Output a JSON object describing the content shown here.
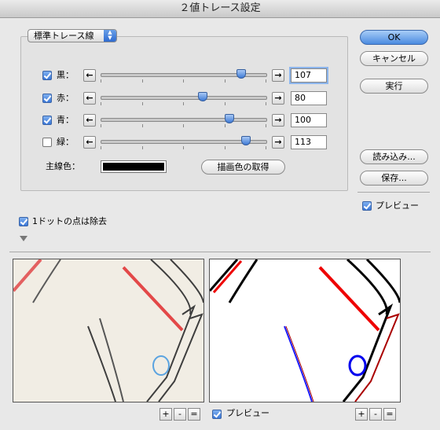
{
  "window": {
    "title": "２値トレース設定"
  },
  "preset": {
    "value": "標準トレース線"
  },
  "colors": [
    {
      "label": "黒：",
      "checked": true,
      "value": "107",
      "level": 0.85,
      "focused": true
    },
    {
      "label": "赤：",
      "checked": true,
      "value": "80",
      "level": 0.62,
      "focused": false
    },
    {
      "label": "青：",
      "checked": true,
      "value": "100",
      "level": 0.78,
      "focused": false
    },
    {
      "label": "緑：",
      "checked": false,
      "value": "113",
      "level": 0.88,
      "focused": false
    }
  ],
  "arrows": {
    "left": "←",
    "right": "→"
  },
  "main_line": {
    "label": "主線色：",
    "color": "#000000",
    "get_button": "描画色の取得"
  },
  "buttons": {
    "ok": "OK",
    "cancel": "キャンセル",
    "run": "実行",
    "load": "読み込み...",
    "save": "保存..."
  },
  "preview": {
    "label": "プレビュー",
    "checked": true
  },
  "remove_dots": {
    "label": "1ドットの点は除去",
    "checked": true
  },
  "bottom": {
    "preview_label": "プレビュー",
    "zoom_plus": "+",
    "zoom_minus": "-",
    "zoom_fit": "="
  },
  "accent": "#3b78d8"
}
